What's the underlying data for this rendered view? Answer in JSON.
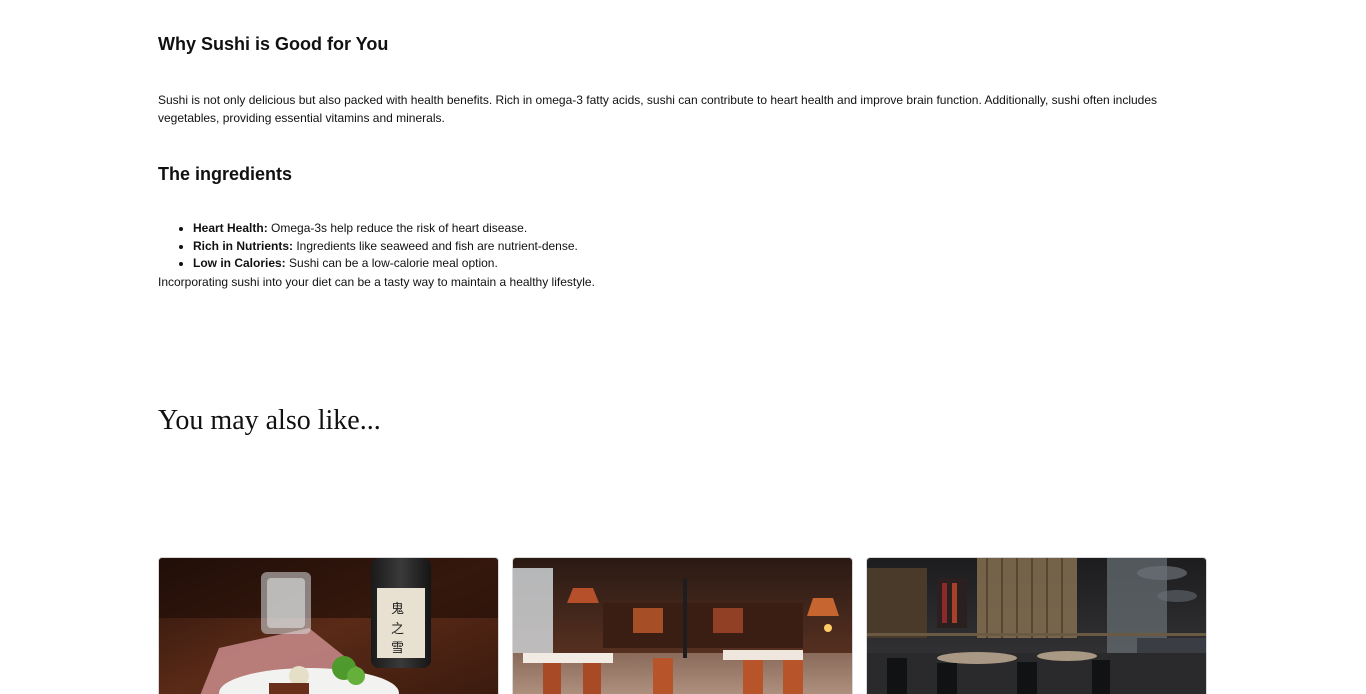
{
  "sections": {
    "why": {
      "heading": "Why Sushi is Good for You",
      "body": "Sushi is not only delicious but also packed with health benefits. Rich in omega-3 fatty acids, sushi can contribute to heart health and improve brain function. Additionally, sushi often includes vegetables, providing essential vitamins and minerals."
    },
    "ingredients": {
      "heading": "The ingredients",
      "items": [
        {
          "label": "Heart Health:",
          "text": " Omega-3s help reduce the risk of heart disease."
        },
        {
          "label": "Rich in Nutrients:",
          "text": " Ingredients like seaweed and fish are nutrient-dense."
        },
        {
          "label": "Low in Calories:",
          "text": " Sushi can be a low-calorie meal option."
        }
      ],
      "closing": "Incorporating sushi into your diet can be a tasty way to maintain a healthy lifestyle."
    }
  },
  "related": {
    "heading": "You may also like...",
    "cards": [
      {
        "image": "sake-and-sushi-plate-photo"
      },
      {
        "image": "restaurant-interior-warm-photo"
      },
      {
        "image": "restaurant-interior-dark-photo"
      }
    ]
  }
}
